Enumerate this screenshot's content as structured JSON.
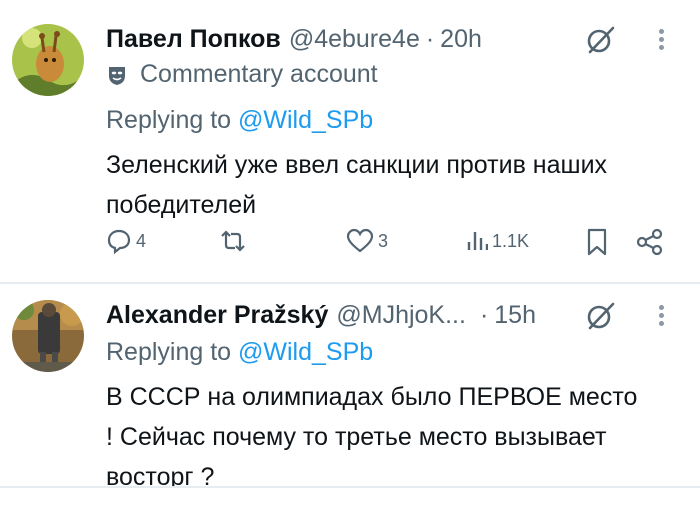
{
  "tweets": [
    {
      "author_name": "Павел Попков",
      "handle": "@4ebure4e",
      "separator": "·",
      "time": "20h",
      "badge_text": "Commentary account",
      "replying_prefix": "Replying to",
      "replying_handle": "@Wild_SPb",
      "text": "Зеленский уже ввел санкции против наших победителей",
      "replies": "4",
      "retweets": "",
      "likes": "3",
      "views": "1.1K"
    },
    {
      "author_name": "Alexander Pražský",
      "handle": "@MJhjoK...",
      "separator": "·",
      "time": "15h",
      "replying_prefix": "Replying to",
      "replying_handle": "@Wild_SPb",
      "text": "В СССР на олимпиадах было ПЕРВОЕ место ! Сейчас почему то третье место вызывает восторг ?"
    }
  ],
  "colors": {
    "text_primary": "#0f1419",
    "text_secondary": "#536471",
    "link": "#1d9bf0",
    "divider": "#e6ecf0"
  },
  "icons": [
    "grok-icon",
    "more-icon",
    "mask-icon",
    "reply-icon",
    "retweet-icon",
    "like-icon",
    "views-icon",
    "bookmark-icon",
    "share-icon"
  ]
}
